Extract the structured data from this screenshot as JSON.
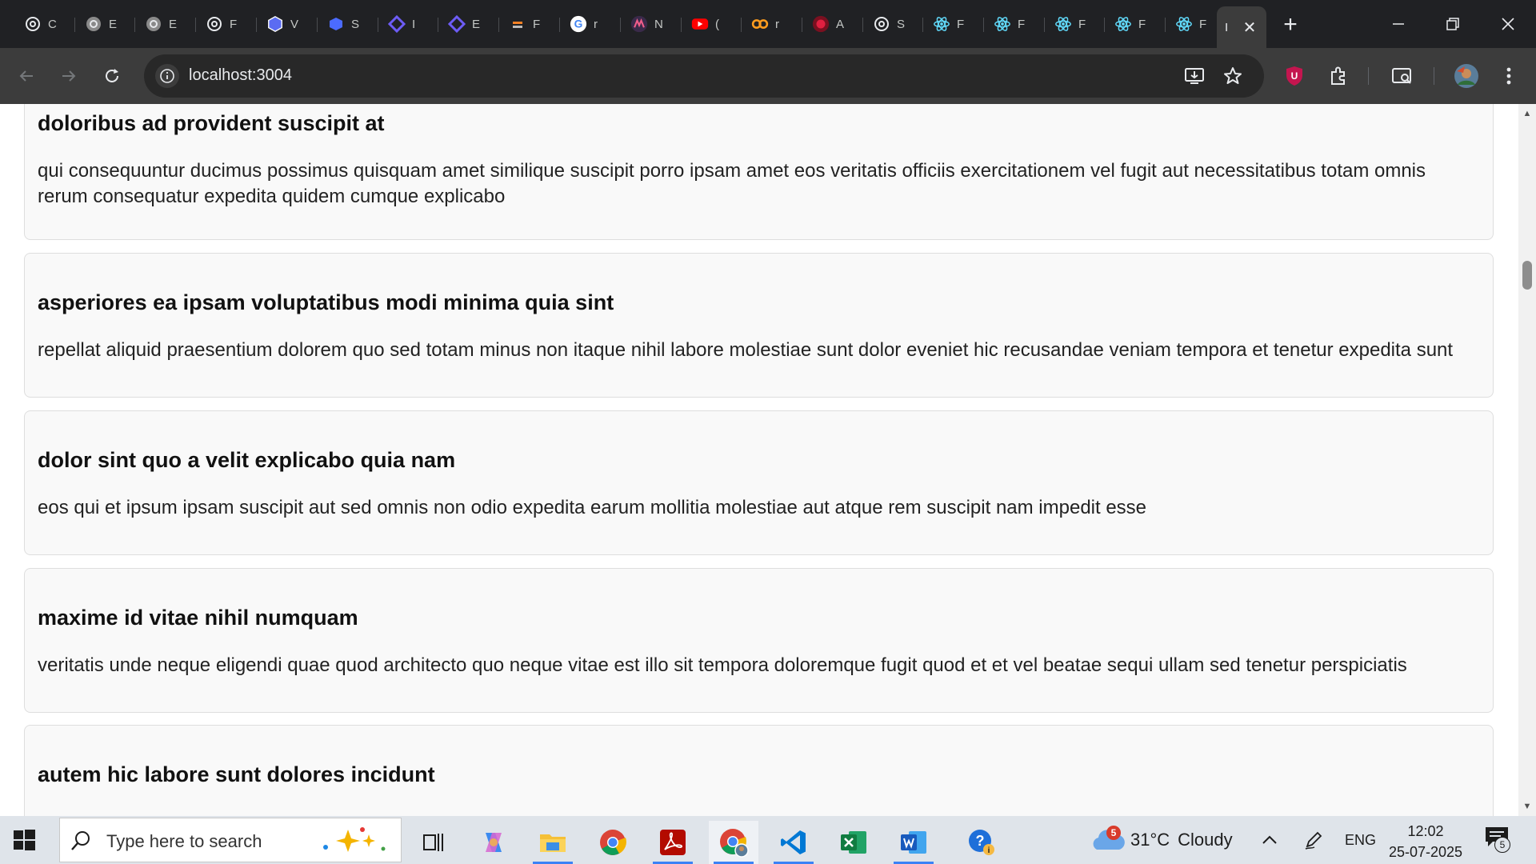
{
  "browser": {
    "tabs": [
      {
        "icon": "openai-icon",
        "title": "C"
      },
      {
        "icon": "openai-grey-icon",
        "title": "E"
      },
      {
        "icon": "openai-grey-icon",
        "title": "E"
      },
      {
        "icon": "openai-icon",
        "title": "F"
      },
      {
        "icon": "shield-hex-icon",
        "title": "V"
      },
      {
        "icon": "cube-icon",
        "title": "S"
      },
      {
        "icon": "code-diamond-icon",
        "title": "I"
      },
      {
        "icon": "code-diamond-icon",
        "title": "E"
      },
      {
        "icon": "stack-icon",
        "title": "F"
      },
      {
        "icon": "google-icon",
        "title": "r"
      },
      {
        "icon": "mindmap-icon",
        "title": "N"
      },
      {
        "icon": "youtube-icon",
        "title": "("
      },
      {
        "icon": "infinity-icon",
        "title": "r"
      },
      {
        "icon": "circle-red-icon",
        "title": "A"
      },
      {
        "icon": "openai-icon",
        "title": "S"
      },
      {
        "icon": "react-icon",
        "title": "F"
      },
      {
        "icon": "react-icon",
        "title": "F"
      },
      {
        "icon": "react-icon",
        "title": "F"
      },
      {
        "icon": "react-icon",
        "title": "F"
      },
      {
        "icon": "react-icon",
        "title": "F"
      },
      {
        "icon": "blank-icon",
        "title": "I",
        "active": true
      }
    ],
    "url": "localhost:3004"
  },
  "page": {
    "posts": [
      {
        "title": "doloribus ad provident suscipit at",
        "body": "qui consequuntur ducimus possimus quisquam amet similique suscipit porro ipsam amet eos veritatis officiis exercitationem vel fugit aut necessitatibus totam omnis rerum consequatur expedita quidem cumque explicabo"
      },
      {
        "title": "asperiores ea ipsam voluptatibus modi minima quia sint",
        "body": "repellat aliquid praesentium dolorem quo sed totam minus non itaque nihil labore molestiae sunt dolor eveniet hic recusandae veniam tempora et tenetur expedita sunt"
      },
      {
        "title": "dolor sint quo a velit explicabo quia nam",
        "body": "eos qui et ipsum ipsam suscipit aut sed omnis non odio expedita earum mollitia molestiae aut atque rem suscipit nam impedit esse"
      },
      {
        "title": "maxime id vitae nihil numquam",
        "body": "veritatis unde neque eligendi quae quod architecto quo neque vitae est illo sit tempora doloremque fugit quod et et vel beatae sequi ullam sed tenetur perspiciatis"
      },
      {
        "title": "autem hic labore sunt dolores incidunt",
        "body": ""
      }
    ]
  },
  "taskbar": {
    "search_placeholder": "Type here to search",
    "weather": {
      "temp": "31°C",
      "condition": "Cloudy",
      "badge": "5"
    },
    "language": "ENG",
    "time": "12:02",
    "date": "25-07-2025",
    "notification_count": "5"
  },
  "colors": {
    "tabstrip": "#202124",
    "toolbar": "#3c3c3c",
    "card_bg": "#f9f9f9",
    "taskbar": "#dfe4ea",
    "accent_indicator": "#3b82f6"
  }
}
